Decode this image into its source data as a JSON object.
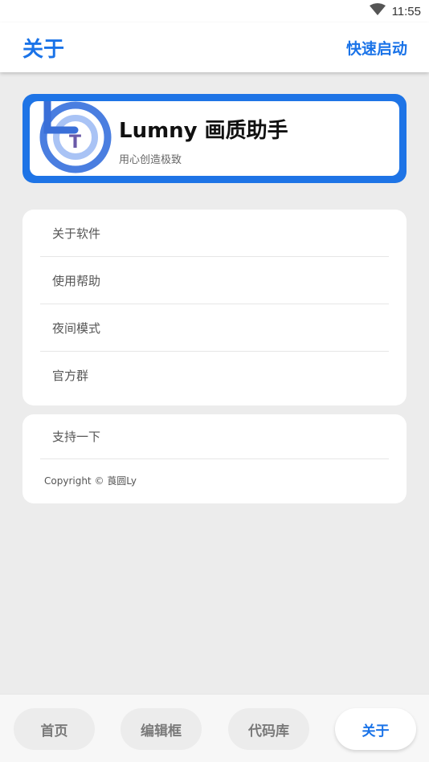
{
  "status_bar": {
    "time": "11:55",
    "wifi_icon": "wifi-icon"
  },
  "app_bar": {
    "title": "关于",
    "action_label": "快速启动"
  },
  "brand": {
    "name": "Lumny 画质助手",
    "slogan": "用心创造极致",
    "logo_letter": "T",
    "accent_color": "#1e74e6"
  },
  "menu": {
    "items": [
      {
        "label": "关于软件"
      },
      {
        "label": "使用帮助"
      },
      {
        "label": "夜间模式"
      },
      {
        "label": "官方群"
      }
    ]
  },
  "support": {
    "label": "支持一下",
    "copyright": "Copyright © 莨圆Ly"
  },
  "bottom_nav": {
    "tabs": [
      {
        "label": "首页",
        "active": false
      },
      {
        "label": "编辑框",
        "active": false
      },
      {
        "label": "代码库",
        "active": false
      },
      {
        "label": "关于",
        "active": true
      }
    ]
  },
  "colors": {
    "primary": "#1a73e8",
    "background": "#ececec"
  }
}
